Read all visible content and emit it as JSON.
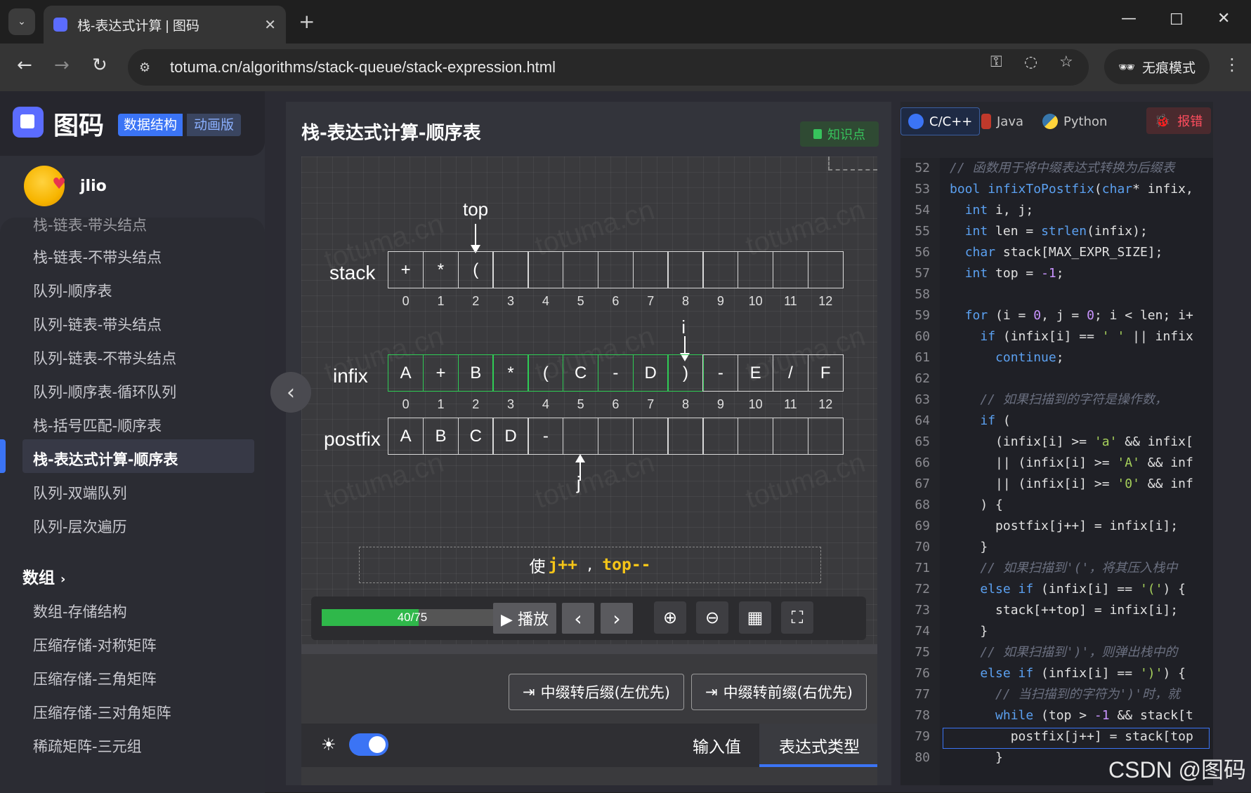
{
  "browser": {
    "tab_title": "栈-表达式计算 | 图码",
    "url": "totuma.cn/algorithms/stack-queue/stack-expression.html",
    "incognito_label": "无痕模式"
  },
  "site": {
    "brand_name": "图码",
    "tag_structure": "数据结构",
    "tag_anim": "动画版",
    "username": "jlio"
  },
  "sidebar": {
    "items": [
      {
        "label": "栈-链表-带头结点"
      },
      {
        "label": "栈-链表-不带头结点"
      },
      {
        "label": "队列-顺序表"
      },
      {
        "label": "队列-链表-带头结点"
      },
      {
        "label": "队列-链表-不带头结点"
      },
      {
        "label": "队列-顺序表-循环队列"
      },
      {
        "label": "栈-括号匹配-顺序表"
      },
      {
        "label": "栈-表达式计算-顺序表"
      },
      {
        "label": "队列-双端队列"
      },
      {
        "label": "队列-层次遍历"
      }
    ],
    "group_title": "数组",
    "group_items": [
      {
        "label": "数组-存储结构"
      },
      {
        "label": "压缩存储-对称矩阵"
      },
      {
        "label": "压缩存储-三角矩阵"
      },
      {
        "label": "压缩存储-三对角矩阵"
      },
      {
        "label": "稀疏矩阵-三元组"
      }
    ]
  },
  "main": {
    "title": "栈-表达式计算-顺序表",
    "knowledge_btn": "知识点",
    "rows": {
      "stack_label": "stack",
      "infix_label": "infix",
      "postfix_label": "postfix",
      "stack_cells": [
        "+",
        "*",
        "(",
        "",
        "",
        "",
        "",
        "",
        "",
        "",
        "",
        "",
        ""
      ],
      "infix_cells": [
        "A",
        "+",
        "B",
        "*",
        "(",
        "C",
        "-",
        "D",
        ")",
        "-",
        "E",
        "/",
        "F"
      ],
      "postfix_cells": [
        "A",
        "B",
        "C",
        "D",
        "-",
        "",
        "",
        "",
        "",
        "",
        "",
        "",
        ""
      ],
      "indices": [
        "0",
        "1",
        "2",
        "3",
        "4",
        "5",
        "6",
        "7",
        "8",
        "9",
        "10",
        "11",
        "12"
      ],
      "infix_scanned_upto": 8
    },
    "pointers": {
      "top": "top",
      "i": "i",
      "j": "j",
      "top_index": 2,
      "i_index": 8,
      "j_index": 5
    },
    "message": {
      "prefix": "使",
      "part1": "j++",
      "sep": ",",
      "part2": "top--"
    },
    "progress": {
      "current": 40,
      "total": 75,
      "text": "40/75"
    },
    "controls": {
      "play": "▶ 播放",
      "prev": "‹",
      "next": "›"
    },
    "modes": {
      "postfix": "中缀转后缀(左优先)",
      "prefix": "中缀转前缀(右优先)"
    },
    "tabs": {
      "input": "输入值",
      "expr_type": "表达式类型"
    }
  },
  "code": {
    "langs": {
      "c": "C/C++",
      "java": "Java",
      "python": "Python"
    },
    "report": "报错",
    "highlight_line": 79,
    "lines": [
      {
        "n": "52"
      },
      {
        "n": "53"
      },
      {
        "n": "54"
      },
      {
        "n": "55"
      },
      {
        "n": "56"
      },
      {
        "n": "57"
      },
      {
        "n": "58"
      },
      {
        "n": "59"
      },
      {
        "n": "60"
      },
      {
        "n": "61"
      },
      {
        "n": "62"
      },
      {
        "n": "63"
      },
      {
        "n": "64"
      },
      {
        "n": "65"
      },
      {
        "n": "66"
      },
      {
        "n": "67"
      },
      {
        "n": "68"
      },
      {
        "n": "69"
      },
      {
        "n": "70"
      },
      {
        "n": "71"
      },
      {
        "n": "72"
      },
      {
        "n": "73"
      },
      {
        "n": "74"
      },
      {
        "n": "75"
      },
      {
        "n": "76"
      },
      {
        "n": "77"
      },
      {
        "n": "78"
      },
      {
        "n": "79"
      },
      {
        "n": "80"
      }
    ]
  },
  "watermark": "CSDN @图码",
  "colors": {
    "accent": "#3b74f5",
    "scanned": "#2fcc55",
    "highlight_text": "#f5c518",
    "progress": "#2fb84a"
  }
}
